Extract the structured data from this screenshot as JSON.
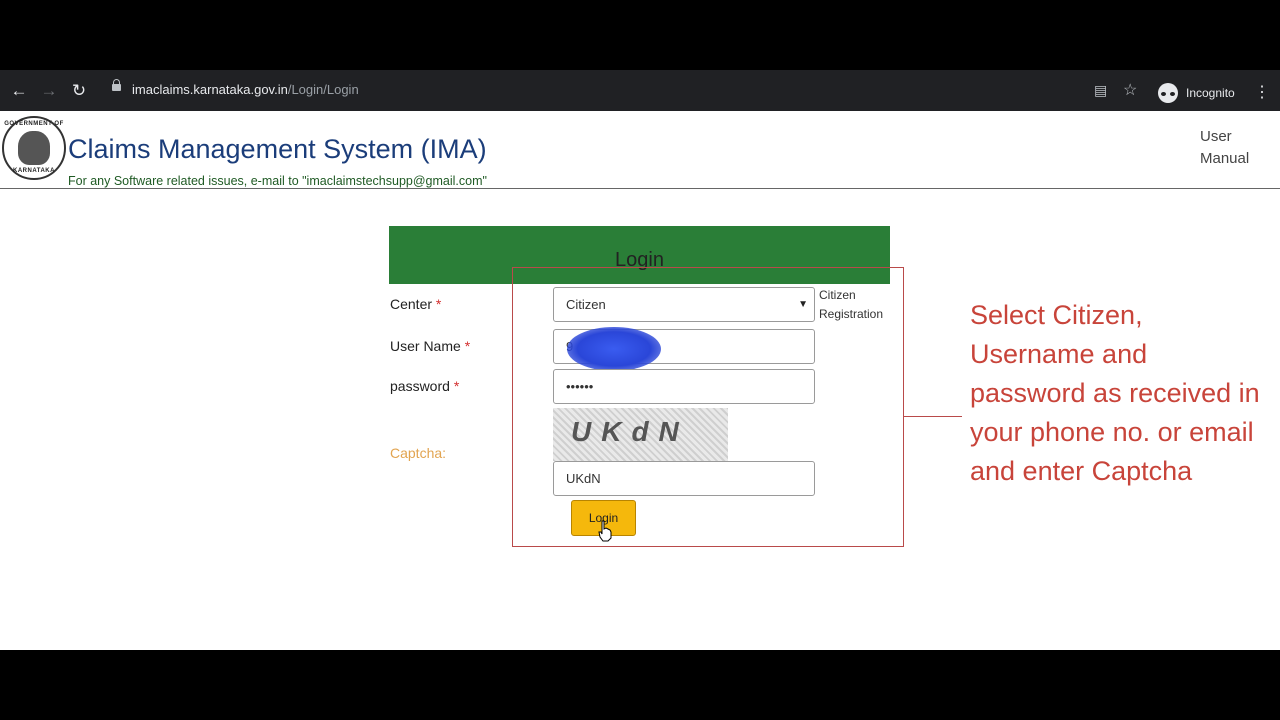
{
  "browser": {
    "url_host": "imaclaims.karnataka.gov.in",
    "url_path": "/Login/Login",
    "mode_label": "Incognito",
    "icons": [
      "back-arrow-icon",
      "forward-arrow-icon",
      "reload-icon",
      "lock-icon",
      "translate-icon",
      "star-icon",
      "incognito-icon",
      "kebab-menu-icon"
    ]
  },
  "header": {
    "emblem_top": "GOVERNMENT OF",
    "emblem_bottom": "KARNATAKA",
    "title": "Claims Management System (IMA)",
    "subtitle": "For any Software related issues, e-mail to \"imaclaimstechsupp@gmail.com\"",
    "user_manual": "User Manual"
  },
  "login": {
    "heading": "Login",
    "center_label": "Center",
    "center_value": "Citizen",
    "username_label": "User Name",
    "username_value": "9",
    "password_label": "password",
    "password_value": "••••••",
    "captcha_label": "Captcha:",
    "captcha_image_text": "UKdN",
    "captcha_value": "UKdN",
    "button_label": "Login",
    "required_mark": "*",
    "citizen_registration": "Citizen Registration"
  },
  "annotation": {
    "text": "Select Citizen, Username and password as received in your phone no. or email and enter Captcha",
    "color": "#c8443a"
  },
  "colors": {
    "banner_green": "#2a7e37",
    "button_yellow": "#f5b80c",
    "title_blue": "#1b3d7a"
  }
}
